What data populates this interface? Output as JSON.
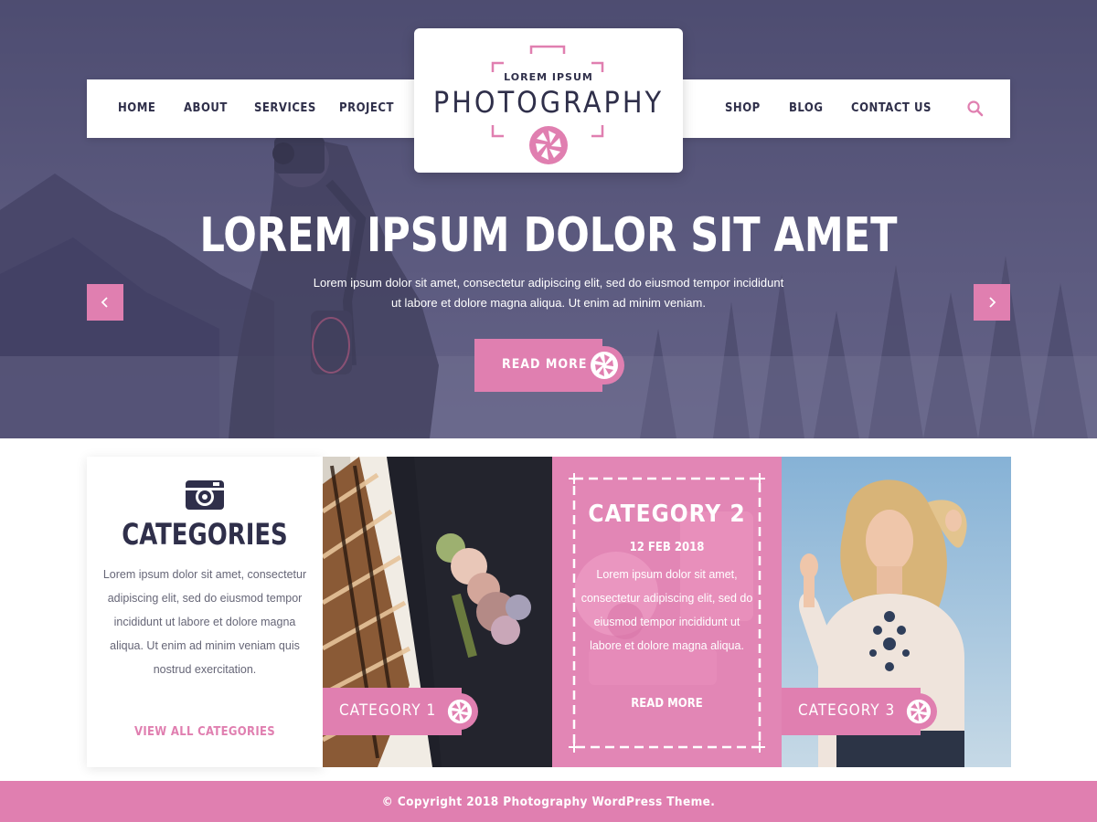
{
  "colors": {
    "accent": "#e07fb0",
    "dark": "#2f2f4a",
    "hero_overlay": "#55547a"
  },
  "nav": {
    "items_left": [
      {
        "label": "HOME"
      },
      {
        "label": "ABOUT"
      },
      {
        "label": "SERVICES"
      },
      {
        "label": "PROJECT"
      }
    ],
    "items_right": [
      {
        "label": "SHOP"
      },
      {
        "label": "BLOG"
      },
      {
        "label": "CONTACT US"
      }
    ],
    "search_icon": "search-icon"
  },
  "logo": {
    "small_text": "LOREM IPSUM",
    "big_text": "PHOTOGRAPHY",
    "icon": "aperture-icon"
  },
  "hero": {
    "title": "LOREM IPSUM DOLOR SIT AMET",
    "text_line1": "Lorem ipsum dolor sit amet, consectetur adipiscing elit, sed do eiusmod tempor incididunt",
    "text_line2": "ut labore et dolore magna aliqua. Ut enim ad minim veniam.",
    "button_label": "READ MORE",
    "prev_icon": "chevron-left-icon",
    "next_icon": "chevron-right-icon"
  },
  "categories": {
    "icon": "camera-icon",
    "title": "CATEGORIES",
    "description": "Lorem ipsum dolor sit amet, consectetur adipiscing elit, sed do eiusmod tempor incididunt ut labore et dolore magna aliqua. Ut enim ad minim veniam quis nostrud exercitation.",
    "link_label": "VIEW ALL CATEGORIES",
    "tiles": [
      {
        "label": "CATEGORY 1"
      },
      {
        "label": "CATEGORY 3"
      }
    ],
    "featured": {
      "title": "CATEGORY 2",
      "date": "12 FEB 2018",
      "description": "Lorem ipsum dolor sit amet, consectetur adipiscing elit, sed do eiusmod tempor incididunt ut labore et dolore magna aliqua.",
      "link_label": "READ MORE"
    }
  },
  "footer": {
    "text": "© Copyright 2018 Photography WordPress Theme."
  }
}
